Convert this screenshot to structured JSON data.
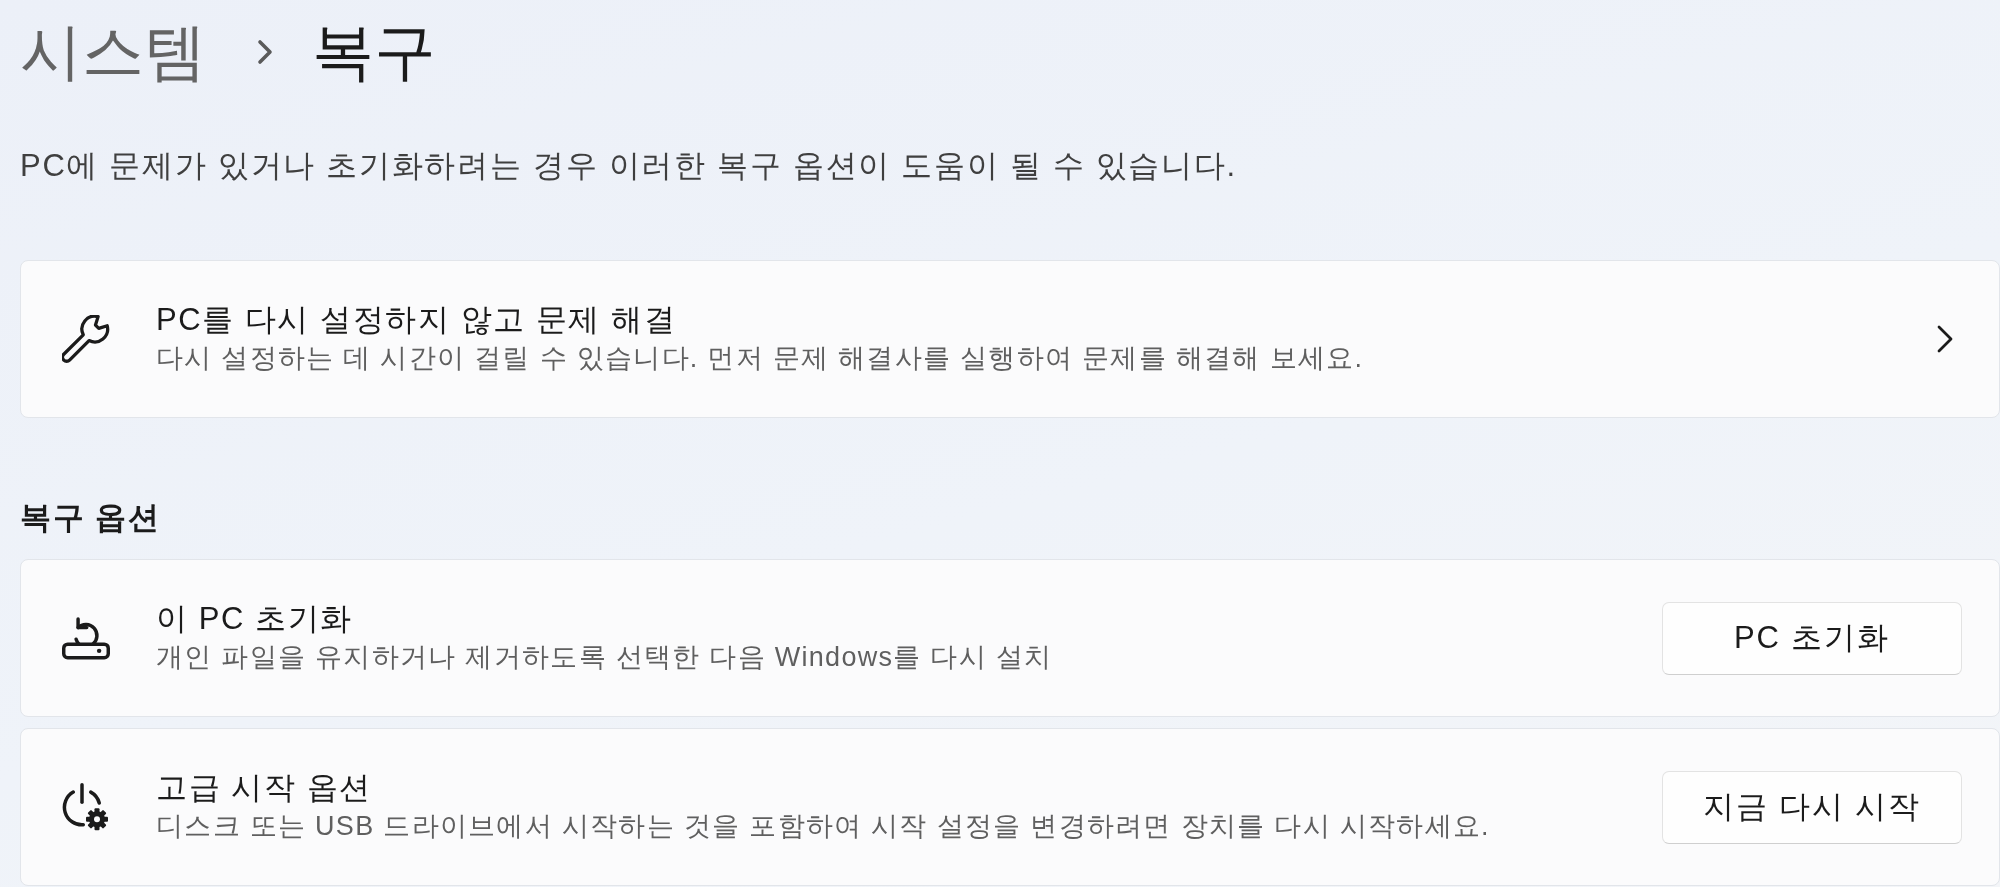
{
  "breadcrumb": [
    {
      "label": "시스템",
      "current": false
    },
    {
      "label": "복구",
      "current": true
    }
  ],
  "description": "PC에 문제가 있거나 초기화하려는 경우 이러한 복구 옵션이 도움이 될 수 있습니다.",
  "troubleshoot_card": {
    "title": "PC를 다시 설정하지 않고 문제 해결",
    "subtitle": "다시 설정하는 데 시간이 걸릴 수 있습니다. 먼저 문제 해결사를 실행하여 문제를 해결해 보세요."
  },
  "recovery_options": {
    "heading": "복구 옵션",
    "items": [
      {
        "title": "이 PC 초기화",
        "subtitle": "개인 파일을 유지하거나 제거하도록 선택한 다음 Windows를 다시 설치",
        "button": "PC 초기화"
      },
      {
        "title": "고급 시작 옵션",
        "subtitle": "디스크 또는 USB 드라이브에서 시작하는 것을 포함하여 시작 설정을 변경하려면 장치를 다시 시작하세요.",
        "button": "지금 다시 시작"
      }
    ]
  }
}
